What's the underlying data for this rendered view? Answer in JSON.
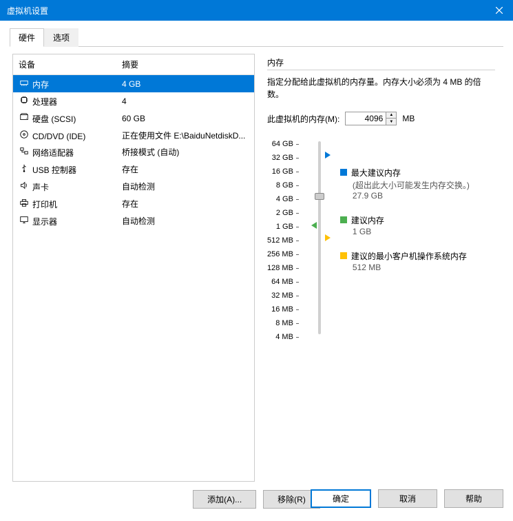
{
  "title": "虚拟机设置",
  "tabs": {
    "hardware": "硬件",
    "options": "选项"
  },
  "table": {
    "col_device": "设备",
    "col_summary": "摘要",
    "rows": [
      {
        "name": "内存",
        "summary": "4 GB",
        "icon": "memory"
      },
      {
        "name": "处理器",
        "summary": "4",
        "icon": "cpu"
      },
      {
        "name": "硬盘 (SCSI)",
        "summary": "60 GB",
        "icon": "disk"
      },
      {
        "name": "CD/DVD (IDE)",
        "summary": "正在使用文件 E:\\BaiduNetdiskD...",
        "icon": "cd"
      },
      {
        "name": "网络适配器",
        "summary": "桥接模式 (自动)",
        "icon": "network"
      },
      {
        "name": "USB 控制器",
        "summary": "存在",
        "icon": "usb"
      },
      {
        "name": "声卡",
        "summary": "自动检测",
        "icon": "sound"
      },
      {
        "name": "打印机",
        "summary": "存在",
        "icon": "printer"
      },
      {
        "name": "显示器",
        "summary": "自动检测",
        "icon": "display"
      }
    ]
  },
  "buttons": {
    "add": "添加(A)...",
    "remove": "移除(R)",
    "ok": "确定",
    "cancel": "取消",
    "help": "帮助"
  },
  "memory": {
    "section_title": "内存",
    "description": "指定分配给此虚拟机的内存量。内存大小必须为 4 MB 的倍数。",
    "input_label": "此虚拟机的内存(M):",
    "input_value": "4096",
    "unit": "MB",
    "ticks": [
      "64 GB",
      "32 GB",
      "16 GB",
      "8 GB",
      "4 GB",
      "2 GB",
      "1 GB",
      "512 MB",
      "256 MB",
      "128 MB",
      "64 MB",
      "32 MB",
      "16 MB",
      "8 MB",
      "4 MB"
    ],
    "legend_max_title": "最大建议内存",
    "legend_max_sub": "(超出此大小可能发生内存交换。)",
    "legend_max_value": "27.9 GB",
    "legend_rec_title": "建议内存",
    "legend_rec_value": "1 GB",
    "legend_min_title": "建议的最小客户机操作系统内存",
    "legend_min_value": "512 MB"
  }
}
